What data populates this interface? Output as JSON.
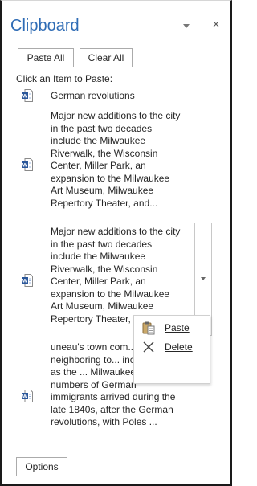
{
  "pane": {
    "title": "Clipboard",
    "paste_all_label": "Paste All",
    "clear_all_label": "Clear All",
    "instruction": "Click an Item to Paste:",
    "options_label": "Options",
    "close_glyph": "×"
  },
  "items": [
    {
      "text": "German revolutions",
      "icon": "word-document-icon"
    },
    {
      "text": "Major new additions to the city in the past two decades include the Milwaukee Riverwalk, the Wisconsin Center, Miller Park, an expansion to the Milwaukee Art Museum, Milwaukee Repertory Theater, and...",
      "icon": "word-document-icon"
    },
    {
      "text": "Major new additions to the city in the past two decades include the Milwaukee Riverwalk, the Wisconsin Center, Miller Park, an expansion to the Milwaukee Art Museum, Milwaukee Repertory Theater, and...",
      "icon": "word-document-icon"
    },
    {
      "text": "uneau's town com... two neighboring to... incorporate as the ... Milwaukee. Large numbers of German immigrants arrived during the late 1840s, after the German revolutions, with Poles ...",
      "icon": "word-document-icon"
    }
  ],
  "context_menu": {
    "paste_label": "Paste",
    "delete_label": "Delete"
  },
  "colors": {
    "title": "#2f6cb5",
    "word_icon_blue": "#2b579a"
  }
}
